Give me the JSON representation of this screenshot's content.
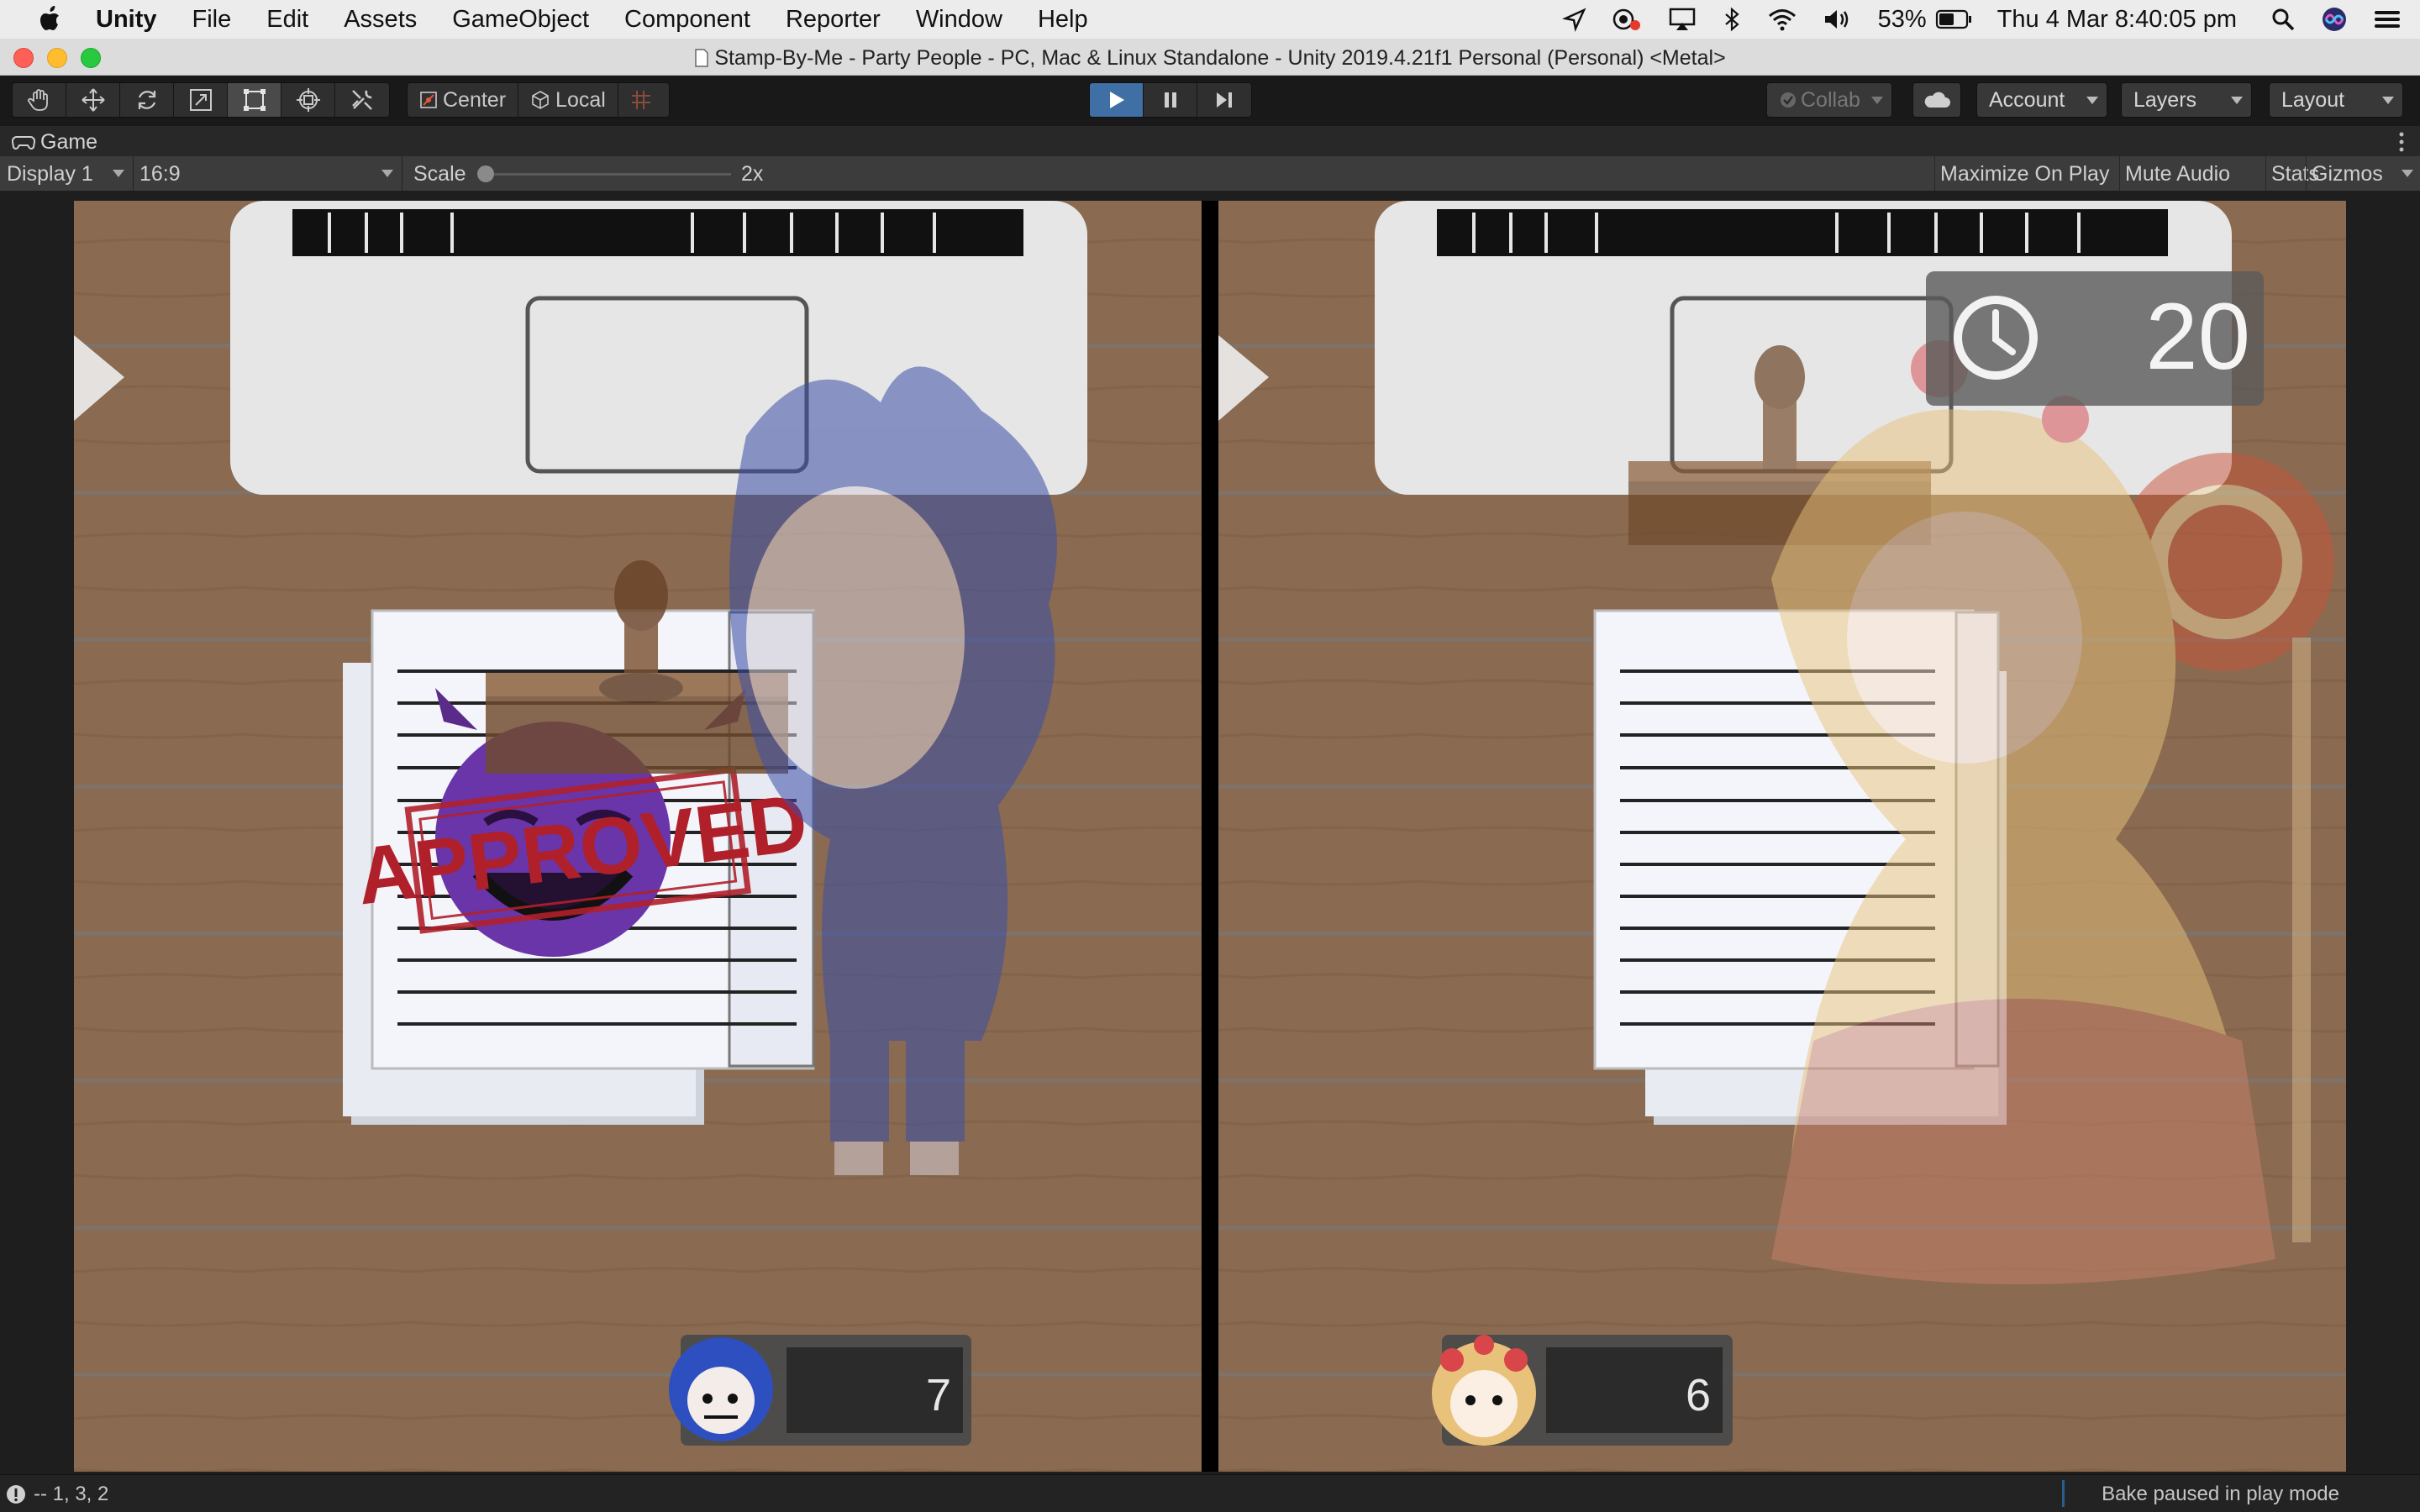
{
  "menubar": {
    "items": [
      "Unity",
      "File",
      "Edit",
      "Assets",
      "GameObject",
      "Component",
      "Reporter",
      "Window",
      "Help"
    ],
    "battery": "53%",
    "datetime": "Thu 4 Mar  8:40:05 pm",
    "status_icons": [
      "location-icon",
      "cast-icon",
      "airplay-icon",
      "bluetooth-icon",
      "wifi-icon",
      "volume-icon",
      "battery-icon",
      "search-icon",
      "siri-icon",
      "control-center-icon"
    ]
  },
  "window": {
    "title": "Stamp-By-Me - Party People - PC, Mac & Linux Standalone - Unity 2019.4.21f1 Personal (Personal) <Metal>"
  },
  "toolbar": {
    "tools": [
      "hand-tool-icon",
      "move-tool-icon",
      "rotate-tool-icon",
      "scale-tool-icon",
      "rect-tool-icon",
      "transform-tool-icon",
      "custom-tool-icon"
    ],
    "active_tool": "rect-tool-icon",
    "pivot_label": "Center",
    "space_label": "Local",
    "play_active": true,
    "collab_label": "Collab",
    "account_label": "Account",
    "layers_label": "Layers",
    "layout_label": "Layout"
  },
  "game_tab": {
    "label": "Game"
  },
  "game_toolbar": {
    "display": "Display 1",
    "aspect": "16:9",
    "scale_label": "Scale",
    "scale_value": "2x",
    "scale_fraction": 0.0,
    "maximize_label": "Maximize On Play",
    "mute_label": "Mute Audio",
    "stats_label": "Stats",
    "gizmos_label": "Gizmos"
  },
  "game": {
    "timer": "20",
    "left_player": {
      "score": "7",
      "stamp_text": "APPROVED"
    },
    "right_player": {
      "score": "6"
    },
    "colors": {
      "desk": "#8a6a50",
      "paper": "#f3f5fb",
      "stamp_red": "#b0202a",
      "player_blue": "#3b4fa8",
      "player_blonde": "#e8c27a"
    }
  },
  "statusbar": {
    "message": "-- 1, 3, 2",
    "bake_status": "Bake paused in play mode"
  }
}
